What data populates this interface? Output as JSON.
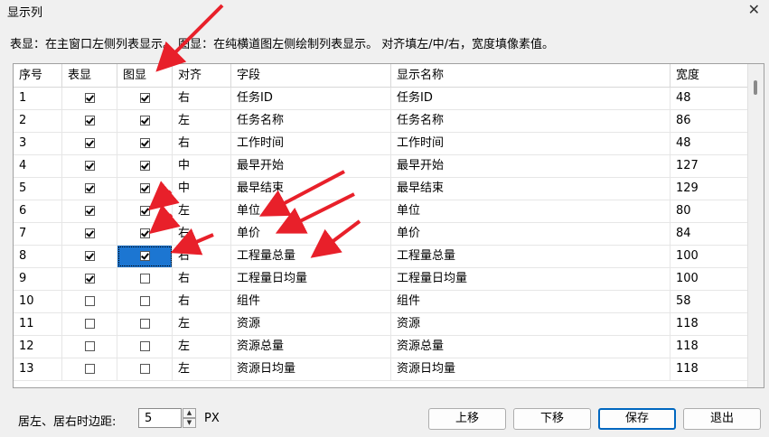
{
  "window": {
    "title": "显示列",
    "close": "✕"
  },
  "description": "表显：在主窗口左侧列表显示。 图显：在纯横道图左侧绘制列表显示。 对齐填左/中/右，宽度填像素值。",
  "columns": [
    "序号",
    "表显",
    "图显",
    "对齐",
    "字段",
    "显示名称",
    "宽度"
  ],
  "rows": [
    {
      "no": "1",
      "table": true,
      "chart": true,
      "align": "右",
      "field": "任务ID",
      "display": "任务ID",
      "width": "48"
    },
    {
      "no": "2",
      "table": true,
      "chart": true,
      "align": "左",
      "field": "任务名称",
      "display": "任务名称",
      "width": "86"
    },
    {
      "no": "3",
      "table": true,
      "chart": true,
      "align": "右",
      "field": "工作时间",
      "display": "工作时间",
      "width": "48"
    },
    {
      "no": "4",
      "table": true,
      "chart": true,
      "align": "中",
      "field": "最早开始",
      "display": "最早开始",
      "width": "127"
    },
    {
      "no": "5",
      "table": true,
      "chart": true,
      "align": "中",
      "field": "最早结束",
      "display": "最早结束",
      "width": "129"
    },
    {
      "no": "6",
      "table": true,
      "chart": true,
      "align": "左",
      "field": "单位",
      "display": "单位",
      "width": "80"
    },
    {
      "no": "7",
      "table": true,
      "chart": true,
      "align": "右",
      "field": "单价",
      "display": "单价",
      "width": "84"
    },
    {
      "no": "8",
      "table": true,
      "chart": true,
      "align": "右",
      "field": "工程量总量",
      "display": "工程量总量",
      "width": "100"
    },
    {
      "no": "9",
      "table": true,
      "chart": false,
      "align": "右",
      "field": "工程量日均量",
      "display": "工程量日均量",
      "width": "100"
    },
    {
      "no": "10",
      "table": false,
      "chart": false,
      "align": "右",
      "field": "组件",
      "display": "组件",
      "width": "58"
    },
    {
      "no": "11",
      "table": false,
      "chart": false,
      "align": "左",
      "field": "资源",
      "display": "资源",
      "width": "118"
    },
    {
      "no": "12",
      "table": false,
      "chart": false,
      "align": "左",
      "field": "资源总量",
      "display": "资源总量",
      "width": "118"
    },
    {
      "no": "13",
      "table": false,
      "chart": false,
      "align": "左",
      "field": "资源日均量",
      "display": "资源日均量",
      "width": "118"
    }
  ],
  "footer": {
    "margin_label": "居左、居右时边距:",
    "margin_value": "5",
    "unit": "PX",
    "up": "上移",
    "down": "下移",
    "save": "保存",
    "exit": "退出"
  }
}
